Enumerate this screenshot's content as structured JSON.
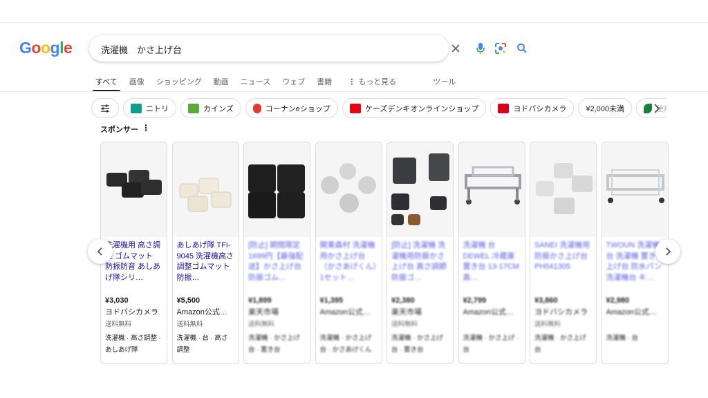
{
  "logo": {
    "letters": [
      "G",
      "o",
      "o",
      "g",
      "l",
      "e"
    ],
    "colors": [
      "#4285F4",
      "#EA4335",
      "#FBBC05",
      "#4285F4",
      "#34A853",
      "#EA4335"
    ]
  },
  "search": {
    "query": "洗濯機　かさ上げ台"
  },
  "tabs": [
    "すべて",
    "画像",
    "ショッピング",
    "動画",
    "ニュース",
    "ウェブ",
    "書籍",
    "もっと見る",
    "ツール"
  ],
  "chips": [
    {
      "label": "",
      "icon": "sliders-icon"
    },
    {
      "label": "ニトリ",
      "icon": "nitori-logo",
      "color": "#0b9f90"
    },
    {
      "label": "カインズ",
      "icon": "cainz-logo",
      "color": "#5aaa3c"
    },
    {
      "label": "コーナンeショップ",
      "icon": "kohnan-logo",
      "color": "#e33b2f"
    },
    {
      "label": "ケーズデンキオンラインショップ",
      "icon": "ksdenki-logo",
      "color": "#e60012"
    },
    {
      "label": "ヨドバシカメラ",
      "icon": "yodobashi-logo",
      "color": "#d7001a"
    },
    {
      "label": "¥2,000未満",
      "icon": ""
    },
    {
      "label": "使用済",
      "icon": "leaf-icon",
      "color": "#188038"
    }
  ],
  "sponsor": "スポンサー",
  "cards": [
    {
      "title": "洗濯機用 高さ調整 ゴムマット 防振防音 あしあげ隊シリ…",
      "price": "¥3,030",
      "store": "ヨドバシカメラ",
      "ship": "送料無料",
      "tags": "洗濯機 · 高さ調整 · あしあげ隊",
      "img": "black-pads"
    },
    {
      "title": "あしあげ隊 TFi-9045 洗濯機高さ調整ゴムマット 防振…",
      "price": "¥5,500",
      "store": "Amazon公式…",
      "ship": "送料無料",
      "tags": "洗濯機 · 台 · 高さ調整",
      "img": "white-pads"
    },
    {
      "title": "[防止] 期間限定1699円【最強配送】かさ上げ台 防振ゴム…",
      "price": "¥1,899",
      "store": "楽天市場",
      "ship": "送料無料",
      "tags": "洗濯機 · かさ上げ台 · 置き台",
      "img": "black-grid"
    },
    {
      "title": "関東森村 洗濯機用かさ上げ台（かさあげくん）1セット…",
      "price": "¥1,395",
      "store": "Amazon公式…",
      "ship": "",
      "tags": "洗濯機 · かさ上げ台 · かさあげくん",
      "img": "grey-pads"
    },
    {
      "title": "[防止] 洗濯機 洗濯機用防振かさ上げ台 高さ調節 防振ゴ…",
      "price": "¥2,380",
      "store": "楽天市場",
      "ship": "送料無料",
      "tags": "洗濯機 · かさ上げ台 · 置き台",
      "img": "black-blocks"
    },
    {
      "title": "洗濯機 台 DEWEL 冷蔵庫置き台 13-17CM高…",
      "price": "¥2,799",
      "store": "Amazon公式…",
      "ship": "",
      "tags": "洗濯機 · かさ上げ · 台",
      "img": "steel-frame"
    },
    {
      "title": "SANEI 洗濯機用防振かさ上げ台 PH541305",
      "price": "¥3,860",
      "store": "ヨドバシカメラ",
      "ship": "送料無料",
      "tags": "洗濯機 · かさ上げ台",
      "img": "grey-blocks"
    },
    {
      "title": "TWOUN 洗濯機 台 洗濯機 置き上げ台 防水パン 洗濯機台 キ…",
      "price": "¥2,980",
      "store": "Amazon公式…",
      "ship": "",
      "tags": "洗濯機 · 台",
      "img": "steel-frame2"
    }
  ]
}
